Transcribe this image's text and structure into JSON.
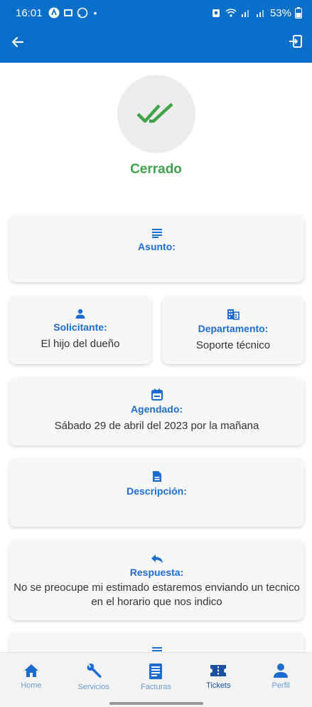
{
  "status_bar": {
    "time": "16:01",
    "battery": "53%"
  },
  "ticket": {
    "status": "Cerrado",
    "asunto": {
      "label": "Asunto:",
      "value": ""
    },
    "solicitante": {
      "label": "Solicitante:",
      "value": "El hijo del dueño"
    },
    "departamento": {
      "label": "Departamento:",
      "value": "Soporte técnico"
    },
    "agendado": {
      "label": "Agendado:",
      "value": "Sábado 29 de abril del 2023 por la mañana"
    },
    "descripcion": {
      "label": "Descripción:",
      "value": ""
    },
    "respuesta": {
      "label": "Respuesta:",
      "value": "No se preocupe mi estimado estaremos enviando un tecnico en el horario que nos indico"
    }
  },
  "nav": {
    "items": [
      {
        "label": "Home",
        "icon": "home-icon"
      },
      {
        "label": "Servicios",
        "icon": "wrench-icon"
      },
      {
        "label": "Facturas",
        "icon": "invoice-icon"
      },
      {
        "label": "Tickets",
        "icon": "ticket-icon"
      },
      {
        "label": "Perfil",
        "icon": "person-icon"
      }
    ],
    "active": "Tickets"
  },
  "colors": {
    "primary": "#0a6fc9",
    "accent": "#1d6dd1",
    "success": "#3fa34a"
  }
}
